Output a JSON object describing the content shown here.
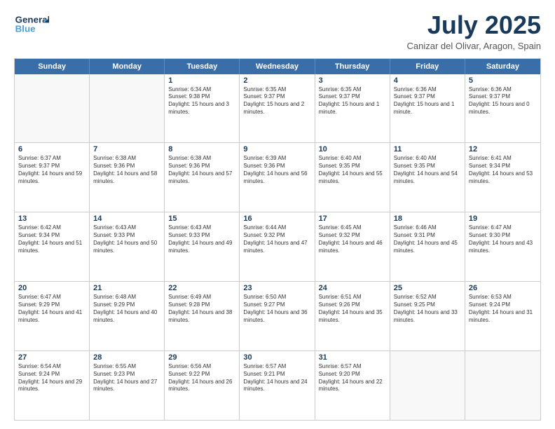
{
  "header": {
    "logo_line1": "General",
    "logo_line2": "Blue",
    "month": "July 2025",
    "location": "Canizar del Olivar, Aragon, Spain"
  },
  "weekdays": [
    "Sunday",
    "Monday",
    "Tuesday",
    "Wednesday",
    "Thursday",
    "Friday",
    "Saturday"
  ],
  "weeks": [
    [
      {
        "day": "",
        "sunrise": "",
        "sunset": "",
        "daylight": ""
      },
      {
        "day": "",
        "sunrise": "",
        "sunset": "",
        "daylight": ""
      },
      {
        "day": "1",
        "sunrise": "Sunrise: 6:34 AM",
        "sunset": "Sunset: 9:38 PM",
        "daylight": "Daylight: 15 hours and 3 minutes."
      },
      {
        "day": "2",
        "sunrise": "Sunrise: 6:35 AM",
        "sunset": "Sunset: 9:37 PM",
        "daylight": "Daylight: 15 hours and 2 minutes."
      },
      {
        "day": "3",
        "sunrise": "Sunrise: 6:35 AM",
        "sunset": "Sunset: 9:37 PM",
        "daylight": "Daylight: 15 hours and 1 minute."
      },
      {
        "day": "4",
        "sunrise": "Sunrise: 6:36 AM",
        "sunset": "Sunset: 9:37 PM",
        "daylight": "Daylight: 15 hours and 1 minute."
      },
      {
        "day": "5",
        "sunrise": "Sunrise: 6:36 AM",
        "sunset": "Sunset: 9:37 PM",
        "daylight": "Daylight: 15 hours and 0 minutes."
      }
    ],
    [
      {
        "day": "6",
        "sunrise": "Sunrise: 6:37 AM",
        "sunset": "Sunset: 9:37 PM",
        "daylight": "Daylight: 14 hours and 59 minutes."
      },
      {
        "day": "7",
        "sunrise": "Sunrise: 6:38 AM",
        "sunset": "Sunset: 9:36 PM",
        "daylight": "Daylight: 14 hours and 58 minutes."
      },
      {
        "day": "8",
        "sunrise": "Sunrise: 6:38 AM",
        "sunset": "Sunset: 9:36 PM",
        "daylight": "Daylight: 14 hours and 57 minutes."
      },
      {
        "day": "9",
        "sunrise": "Sunrise: 6:39 AM",
        "sunset": "Sunset: 9:36 PM",
        "daylight": "Daylight: 14 hours and 56 minutes."
      },
      {
        "day": "10",
        "sunrise": "Sunrise: 6:40 AM",
        "sunset": "Sunset: 9:35 PM",
        "daylight": "Daylight: 14 hours and 55 minutes."
      },
      {
        "day": "11",
        "sunrise": "Sunrise: 6:40 AM",
        "sunset": "Sunset: 9:35 PM",
        "daylight": "Daylight: 14 hours and 54 minutes."
      },
      {
        "day": "12",
        "sunrise": "Sunrise: 6:41 AM",
        "sunset": "Sunset: 9:34 PM",
        "daylight": "Daylight: 14 hours and 53 minutes."
      }
    ],
    [
      {
        "day": "13",
        "sunrise": "Sunrise: 6:42 AM",
        "sunset": "Sunset: 9:34 PM",
        "daylight": "Daylight: 14 hours and 51 minutes."
      },
      {
        "day": "14",
        "sunrise": "Sunrise: 6:43 AM",
        "sunset": "Sunset: 9:33 PM",
        "daylight": "Daylight: 14 hours and 50 minutes."
      },
      {
        "day": "15",
        "sunrise": "Sunrise: 6:43 AM",
        "sunset": "Sunset: 9:33 PM",
        "daylight": "Daylight: 14 hours and 49 minutes."
      },
      {
        "day": "16",
        "sunrise": "Sunrise: 6:44 AM",
        "sunset": "Sunset: 9:32 PM",
        "daylight": "Daylight: 14 hours and 47 minutes."
      },
      {
        "day": "17",
        "sunrise": "Sunrise: 6:45 AM",
        "sunset": "Sunset: 9:32 PM",
        "daylight": "Daylight: 14 hours and 46 minutes."
      },
      {
        "day": "18",
        "sunrise": "Sunrise: 6:46 AM",
        "sunset": "Sunset: 9:31 PM",
        "daylight": "Daylight: 14 hours and 45 minutes."
      },
      {
        "day": "19",
        "sunrise": "Sunrise: 6:47 AM",
        "sunset": "Sunset: 9:30 PM",
        "daylight": "Daylight: 14 hours and 43 minutes."
      }
    ],
    [
      {
        "day": "20",
        "sunrise": "Sunrise: 6:47 AM",
        "sunset": "Sunset: 9:29 PM",
        "daylight": "Daylight: 14 hours and 41 minutes."
      },
      {
        "day": "21",
        "sunrise": "Sunrise: 6:48 AM",
        "sunset": "Sunset: 9:29 PM",
        "daylight": "Daylight: 14 hours and 40 minutes."
      },
      {
        "day": "22",
        "sunrise": "Sunrise: 6:49 AM",
        "sunset": "Sunset: 9:28 PM",
        "daylight": "Daylight: 14 hours and 38 minutes."
      },
      {
        "day": "23",
        "sunrise": "Sunrise: 6:50 AM",
        "sunset": "Sunset: 9:27 PM",
        "daylight": "Daylight: 14 hours and 36 minutes."
      },
      {
        "day": "24",
        "sunrise": "Sunrise: 6:51 AM",
        "sunset": "Sunset: 9:26 PM",
        "daylight": "Daylight: 14 hours and 35 minutes."
      },
      {
        "day": "25",
        "sunrise": "Sunrise: 6:52 AM",
        "sunset": "Sunset: 9:25 PM",
        "daylight": "Daylight: 14 hours and 33 minutes."
      },
      {
        "day": "26",
        "sunrise": "Sunrise: 6:53 AM",
        "sunset": "Sunset: 9:24 PM",
        "daylight": "Daylight: 14 hours and 31 minutes."
      }
    ],
    [
      {
        "day": "27",
        "sunrise": "Sunrise: 6:54 AM",
        "sunset": "Sunset: 9:24 PM",
        "daylight": "Daylight: 14 hours and 29 minutes."
      },
      {
        "day": "28",
        "sunrise": "Sunrise: 6:55 AM",
        "sunset": "Sunset: 9:23 PM",
        "daylight": "Daylight: 14 hours and 27 minutes."
      },
      {
        "day": "29",
        "sunrise": "Sunrise: 6:56 AM",
        "sunset": "Sunset: 9:22 PM",
        "daylight": "Daylight: 14 hours and 26 minutes."
      },
      {
        "day": "30",
        "sunrise": "Sunrise: 6:57 AM",
        "sunset": "Sunset: 9:21 PM",
        "daylight": "Daylight: 14 hours and 24 minutes."
      },
      {
        "day": "31",
        "sunrise": "Sunrise: 6:57 AM",
        "sunset": "Sunset: 9:20 PM",
        "daylight": "Daylight: 14 hours and 22 minutes."
      },
      {
        "day": "",
        "sunrise": "",
        "sunset": "",
        "daylight": ""
      },
      {
        "day": "",
        "sunrise": "",
        "sunset": "",
        "daylight": ""
      }
    ]
  ]
}
